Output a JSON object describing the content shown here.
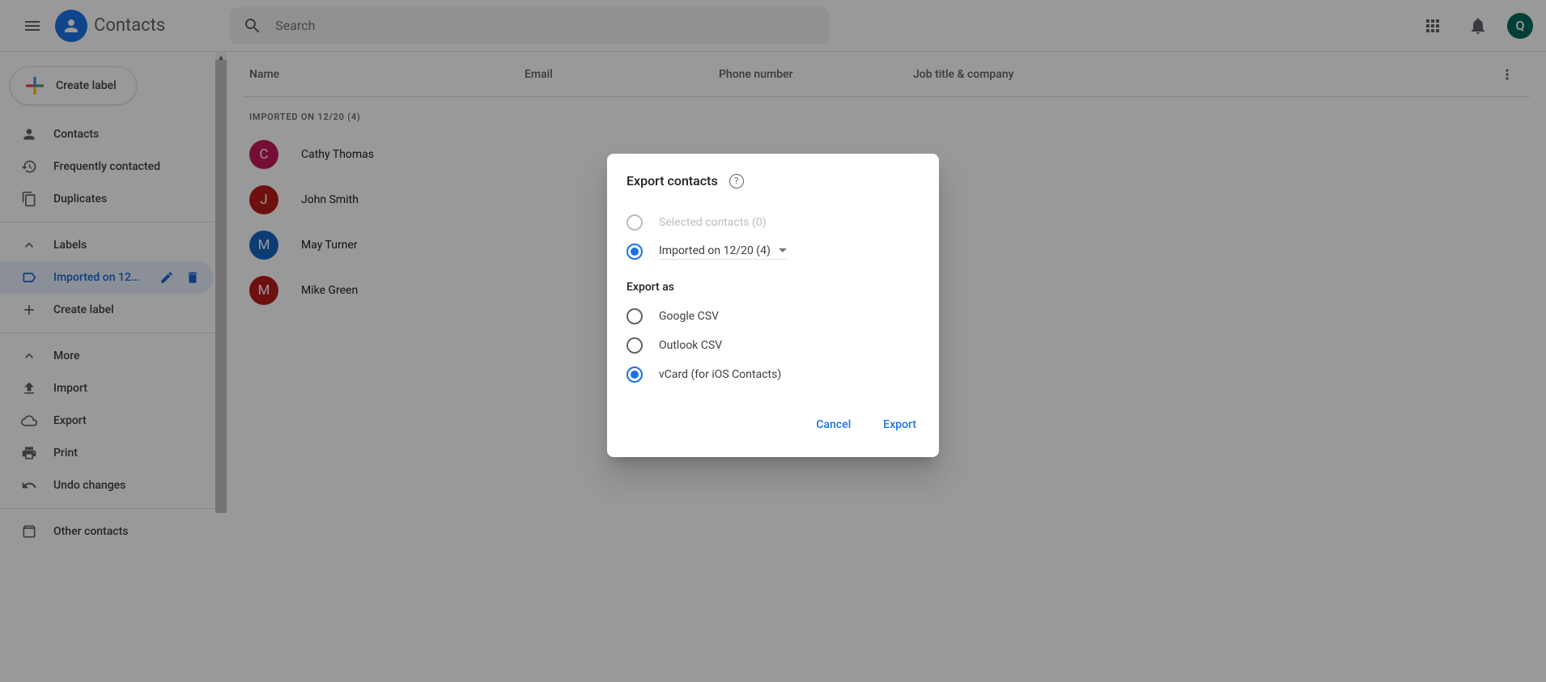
{
  "header": {
    "app_title": "Contacts",
    "search_placeholder": "Search",
    "avatar_letter": "Q"
  },
  "sidebar": {
    "create_label": "Create label",
    "nav": {
      "contacts": "Contacts",
      "frequent": "Frequently contacted",
      "duplicates": "Duplicates"
    },
    "labels_header": "Labels",
    "label_imported": "Imported on 12/...",
    "more": "More",
    "import": "Import",
    "export": "Export",
    "print": "Print",
    "undo": "Undo changes",
    "other": "Other contacts"
  },
  "table": {
    "columns": {
      "name": "Name",
      "email": "Email",
      "phone": "Phone number",
      "job": "Job title & company"
    },
    "group_header": "IMPORTED ON 12/20 (4)",
    "contacts": [
      {
        "initial": "C",
        "name": "Cathy Thomas",
        "color": "#c2185b"
      },
      {
        "initial": "J",
        "name": "John Smith",
        "color": "#b71c1c"
      },
      {
        "initial": "M",
        "name": "May Turner",
        "color": "#1565c0"
      },
      {
        "initial": "M",
        "name": "Mike Green",
        "color": "#b71c1c"
      }
    ]
  },
  "dialog": {
    "title": "Export contacts",
    "selected_option": "Selected contacts (0)",
    "imported_option": "Imported on 12/20 (4)",
    "export_as": "Export as",
    "format_google": "Google CSV",
    "format_outlook": "Outlook CSV",
    "format_vcard": "vCard (for iOS Contacts)",
    "cancel": "Cancel",
    "export": "Export"
  }
}
